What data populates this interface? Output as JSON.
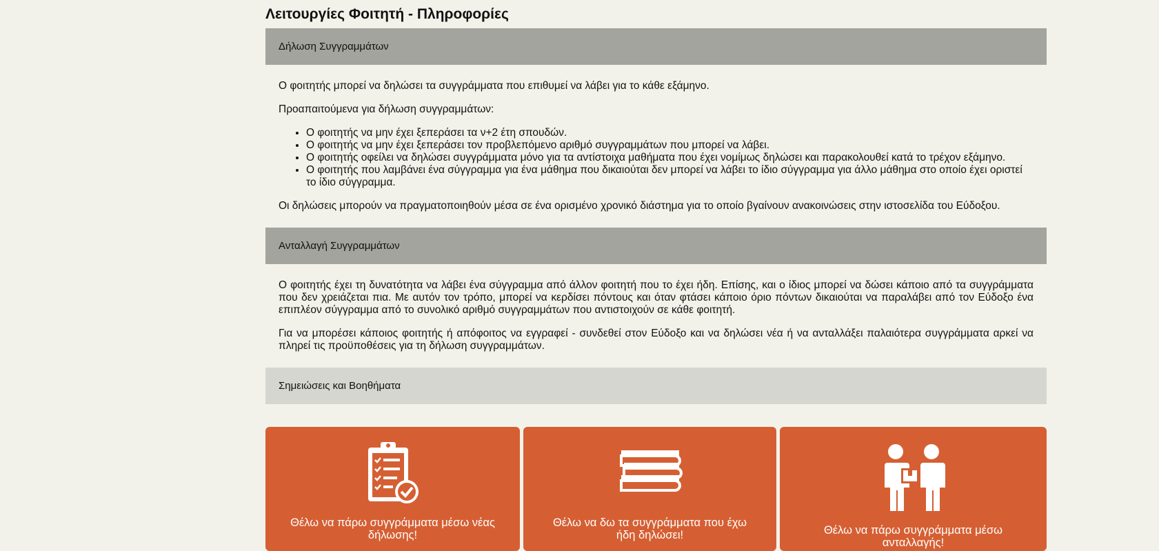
{
  "page": {
    "title": "Λειτουργίες Φοιτητή - Πληροφορίες"
  },
  "sections": {
    "declaration": {
      "header": "Δήλωση Συγγραμμάτων",
      "intro": "Ο φοιτητής μπορεί να δηλώσει τα συγγράμματα που επιθυμεί να λάβει για το κάθε εξάμηνο.",
      "prereq_title": "Προαπαιτούμενα για δήλωση συγγραμμάτων:",
      "prereqs": [
        "Ο φοιτητής να μην έχει ξεπεράσει τα ν+2 έτη σπουδών.",
        "Ο φοιτητής να μην έχει ξεπεράσει τον προβλεπόμενο αριθμό συγγραμμάτων που μπορεί να λάβει.",
        "Ο φοιτητής οφείλει να δηλώσει συγγράμματα μόνο για τα αντίστοιχα μαθήματα που έχει νομίμως δηλώσει και παρακολουθεί κατά το τρέχον εξάμηνο.",
        "Ο φοιτητής που λαμβάνει ένα σύγγραμμα για ένα μάθημα που δικαιούται δεν μπορεί να λάβει το ίδιο σύγγραμμα για άλλο μάθημα στο οποίο έχει οριστεί το ίδιο σύγγραμμα."
      ],
      "outro": "Οι δηλώσεις μπορούν να πραγματοποιηθούν μέσα σε ένα ορισμένο χρονικό διάστημα για το οποίο βγαίνουν ανακοινώσεις στην ιστοσελίδα του Εύδοξου."
    },
    "exchange": {
      "header": "Ανταλλαγή Συγγραμμάτων",
      "para1": "Ο φοιτητής έχει τη δυνατότητα να λάβει ένα σύγγραμμα από άλλον φοιτητή που το έχει ήδη. Επίσης, και ο ίδιος μπορεί να δώσει κάποιο από τα συγγράμματα που δεν χρειάζεται πια. Με αυτόν τον τρόπο, μπορεί να κερδίσει πόντους και όταν φτάσει κάποιο όριο πόντων δικαιούται να παραλάβει από τον Εύδοξο ένα επιπλέον σύγγραμμα από το συνολικό αριθμό συγγραμμάτων που αντιστοιχούν σε κάθε φοιτητή.",
      "para2": "Για να μπορέσει κάποιος φοιτητής ή απόφοιτος να εγγραφεί - συνδεθεί στον Εύδοξο και να δηλώσει νέα ή να ανταλλάξει παλαιότερα συγγράμματα αρκεί να πληρεί τις προϋποθέσεις για τη δήλωση συγγραμμάτων."
    },
    "notes": {
      "header": "Σημειώσεις και Βοηθήματα"
    }
  },
  "cards": [
    {
      "label": "Θέλω να πάρω συγγράμματα μέσω νέας δήλωσης!",
      "icon": "clipboard-check-icon"
    },
    {
      "label": "Θέλω να δω τα συγγράμματα που έχω ήδη δηλώσει!",
      "icon": "books-stack-icon"
    },
    {
      "label": "Θέλω να πάρω συγγράμματα μέσω ανταλλαγής!",
      "icon": "people-exchange-icon"
    }
  ],
  "colors": {
    "background": "#f3f2ea",
    "section_header_dark": "#a4a49e",
    "section_header_light": "#d6d6d0",
    "card_accent": "#d55f33"
  }
}
